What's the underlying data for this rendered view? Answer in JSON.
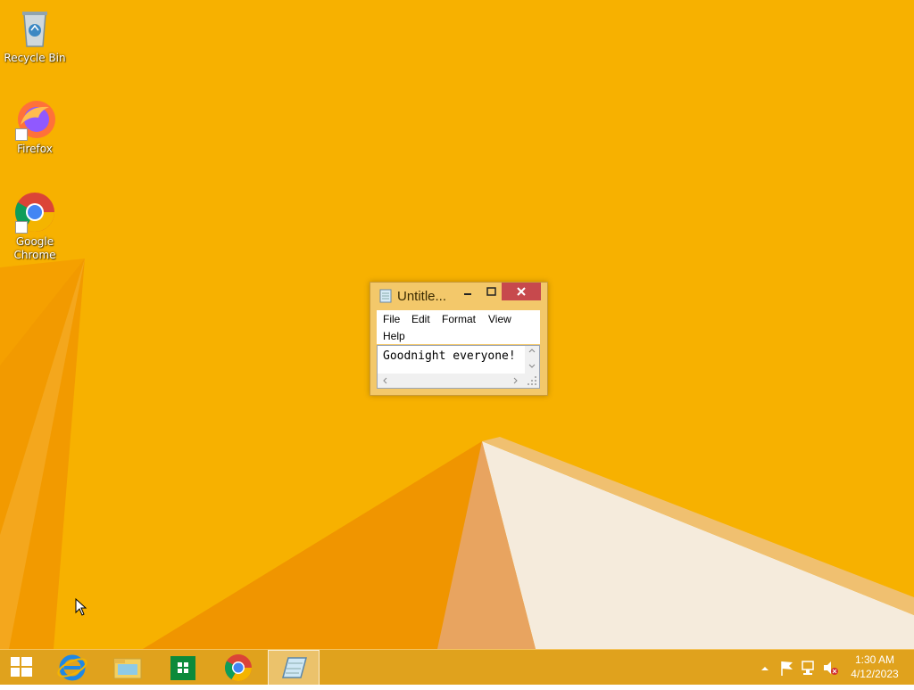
{
  "desktop": {
    "icons": [
      {
        "label": "Recycle Bin",
        "icon": "recycle-bin-icon"
      },
      {
        "label": "Firefox",
        "icon": "firefox-icon"
      },
      {
        "label": "Google Chrome",
        "icon": "chrome-icon"
      }
    ]
  },
  "notepad": {
    "title": "Untitle...",
    "menu": [
      "File",
      "Edit",
      "Format",
      "View",
      "Help"
    ],
    "content": "Goodnight everyone!",
    "controls": {
      "minimize": "–",
      "maximize": "□",
      "close": "✕"
    }
  },
  "taskbar": {
    "apps": [
      {
        "name": "start-button",
        "icon": "windows-logo-icon"
      },
      {
        "name": "internet-explorer",
        "icon": "internet-explorer-icon"
      },
      {
        "name": "file-explorer",
        "icon": "file-explorer-icon"
      },
      {
        "name": "store",
        "icon": "store-icon"
      },
      {
        "name": "chrome",
        "icon": "chrome-icon"
      },
      {
        "name": "notepad",
        "icon": "notepad-icon",
        "active": true
      }
    ],
    "tray": [
      "show-hidden-icons-chevron",
      "action-center-flag-icon",
      "network-icon",
      "volume-muted-icon"
    ],
    "clock": {
      "time": "1:30 AM",
      "date": "4/12/2023"
    }
  },
  "colors": {
    "wallpaper": "#f7b100",
    "taskbar": "#e0a21d",
    "close_button": "#c7494d"
  }
}
